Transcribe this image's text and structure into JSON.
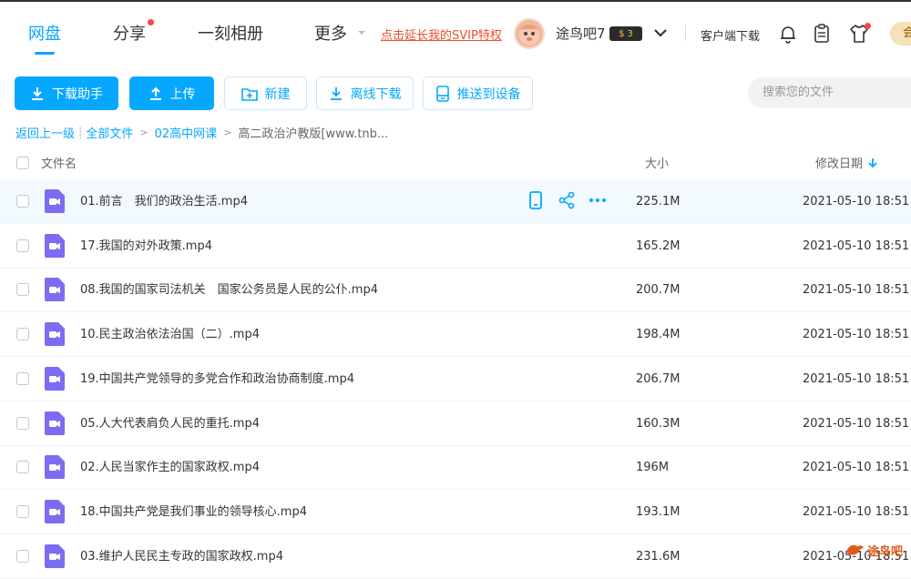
{
  "nav": {
    "netdisk": "网盘",
    "share": "分享",
    "album": "一刻相册",
    "more": "更多"
  },
  "svip_link": "点击延长我的SVIP特权",
  "user": {
    "name": "途鸟吧7",
    "level": "3"
  },
  "client_download": "客户端下载",
  "vip_button": "会",
  "toolbar": {
    "download_helper": "下载助手",
    "upload": "上传",
    "new": "新建",
    "offline_download": "离线下载",
    "push_device": "推送到设备"
  },
  "search": {
    "placeholder": "搜索您的文件"
  },
  "breadcrumb": {
    "back": "返回上一级",
    "all": "全部文件",
    "folder": "02高中网课",
    "current": "高二政治沪教版[www.tnb..."
  },
  "columns": {
    "name": "文件名",
    "size": "大小",
    "date": "修改日期"
  },
  "files": [
    {
      "name": "01.前言　我们的政治生活.mp4",
      "size": "225.1M",
      "date": "2021-05-10 18:51"
    },
    {
      "name": "17.我国的对外政策.mp4",
      "size": "165.2M",
      "date": "2021-05-10 18:51"
    },
    {
      "name": "08.我国的国家司法机关　国家公务员是人民的公仆.mp4",
      "size": "200.7M",
      "date": "2021-05-10 18:51"
    },
    {
      "name": "10.民主政治依法治国（二）.mp4",
      "size": "198.4M",
      "date": "2021-05-10 18:51"
    },
    {
      "name": "19.中国共产党领导的多党合作和政治协商制度.mp4",
      "size": "206.7M",
      "date": "2021-05-10 18:51"
    },
    {
      "name": "05.人大代表肩负人民的重托.mp4",
      "size": "160.3M",
      "date": "2021-05-10 18:51"
    },
    {
      "name": "02.人民当家作主的国家政权.mp4",
      "size": "196M",
      "date": "2021-05-10 18:51"
    },
    {
      "name": "18.中国共产党是我们事业的领导核心.mp4",
      "size": "193.1M",
      "date": "2021-05-10 18:51"
    },
    {
      "name": "03.维护人民民主专政的国家政权.mp4",
      "size": "231.6M",
      "date": "2021-05-10 18:51"
    }
  ],
  "watermark": "途鸟吧",
  "colors": {
    "accent": "#06a7ff",
    "video_icon": "#7c6cf2",
    "svip": "#e8502a"
  },
  "icons": [
    "download-icon",
    "upload-icon",
    "folder-plus-icon",
    "offline-download-icon",
    "device-icon",
    "bell-icon",
    "clipboard-icon",
    "shirt-icon",
    "chevron-down-icon",
    "video-file-icon",
    "phone-icon",
    "share-icon",
    "more-icon",
    "sort-down-icon"
  ]
}
